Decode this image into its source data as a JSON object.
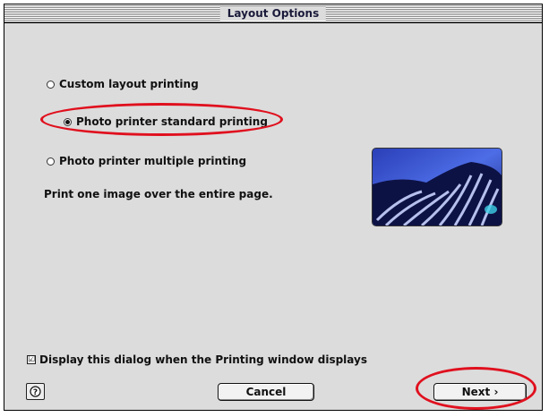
{
  "window": {
    "title": "Layout Options"
  },
  "options": [
    {
      "label": "Custom layout printing",
      "selected": false
    },
    {
      "label": "Photo printer standard printing",
      "selected": true
    },
    {
      "label": "Photo printer multiple printing",
      "selected": false
    }
  ],
  "description": "Print one image over the entire page.",
  "preview": {
    "icon": "zebra-photo-icon"
  },
  "checkbox": {
    "label": "Display this dialog when the Printing window displays",
    "checked": true,
    "mark": "☑"
  },
  "buttons": {
    "help_label": "?",
    "cancel_label": "Cancel",
    "next_label": "Next ›"
  },
  "colors": {
    "highlight": "#e0101e",
    "dialog_bg": "#dcdcdc"
  }
}
